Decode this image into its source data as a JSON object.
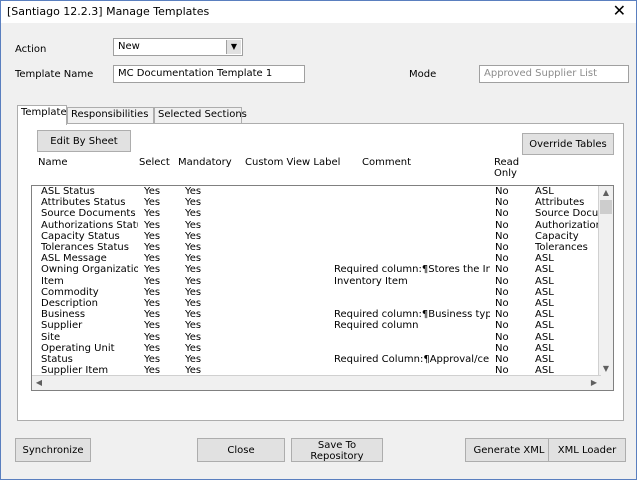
{
  "window": {
    "title": "[Santiago 12.2.3] Manage Templates",
    "close_glyph": "✕"
  },
  "form": {
    "action_label": "Action",
    "action_value": "New",
    "template_name_label": "Template Name",
    "template_name_value": "MC Documentation Template 1",
    "mode_label": "Mode",
    "mode_value": "Approved Supplier List"
  },
  "tabs": [
    {
      "label": "Template",
      "active": true
    },
    {
      "label": "Responsibilities",
      "active": false
    },
    {
      "label": "Selected Sections",
      "active": false
    }
  ],
  "template_tab": {
    "edit_button": "Edit By Sheet",
    "override_button": "Override Tables",
    "columns": {
      "name": "Name",
      "select": "Select",
      "mandatory": "Mandatory",
      "custom_view_label": "Custom View Label",
      "comment": "Comment",
      "read_only_1": "Read",
      "read_only_2": "Only"
    },
    "rows": [
      {
        "name": "ASL Status",
        "select": "Yes",
        "mandatory": "Yes",
        "comment": "",
        "read_only": "No",
        "table": "ASL"
      },
      {
        "name": "Attributes Status",
        "select": "Yes",
        "mandatory": "Yes",
        "comment": "",
        "read_only": "No",
        "table": "Attributes"
      },
      {
        "name": "Source Documents Stat",
        "select": "Yes",
        "mandatory": "Yes",
        "comment": "",
        "read_only": "No",
        "table": "Source Docume"
      },
      {
        "name": "Authorizations Status",
        "select": "Yes",
        "mandatory": "Yes",
        "comment": "",
        "read_only": "No",
        "table": "Authorizations"
      },
      {
        "name": "Capacity Status",
        "select": "Yes",
        "mandatory": "Yes",
        "comment": "",
        "read_only": "No",
        "table": "Capacity"
      },
      {
        "name": "Tolerances Status",
        "select": "Yes",
        "mandatory": "Yes",
        "comment": "",
        "read_only": "No",
        "table": "Tolerances"
      },
      {
        "name": "ASL Message",
        "select": "Yes",
        "mandatory": "Yes",
        "comment": "",
        "read_only": "No",
        "table": "ASL"
      },
      {
        "name": "Owning Organization",
        "select": "Yes",
        "mandatory": "Yes",
        "comment": "Required column:¶Stores the Invento",
        "read_only": "No",
        "table": "ASL"
      },
      {
        "name": "Item",
        "select": "Yes",
        "mandatory": "Yes",
        "comment": "Inventory Item",
        "read_only": "No",
        "table": "ASL"
      },
      {
        "name": "Commodity",
        "select": "Yes",
        "mandatory": "Yes",
        "comment": "",
        "read_only": "No",
        "table": "ASL"
      },
      {
        "name": "Description",
        "select": "Yes",
        "mandatory": "Yes",
        "comment": "",
        "read_only": "No",
        "table": "ASL"
      },
      {
        "name": "Business",
        "select": "Yes",
        "mandatory": "Yes",
        "comment": "Required column:¶Business type of D",
        "read_only": "No",
        "table": "ASL"
      },
      {
        "name": "Supplier",
        "select": "Yes",
        "mandatory": "Yes",
        "comment": "Required column",
        "read_only": "No",
        "table": "ASL"
      },
      {
        "name": "Site",
        "select": "Yes",
        "mandatory": "Yes",
        "comment": "",
        "read_only": "No",
        "table": "ASL"
      },
      {
        "name": "Operating Unit",
        "select": "Yes",
        "mandatory": "Yes",
        "comment": "",
        "read_only": "No",
        "table": "ASL"
      },
      {
        "name": "Status",
        "select": "Yes",
        "mandatory": "Yes",
        "comment": "Required Column:¶Approval/certifica",
        "read_only": "No",
        "table": "ASL"
      },
      {
        "name": "Supplier Item",
        "select": "Yes",
        "mandatory": "Yes",
        "comment": "",
        "read_only": "No",
        "table": "ASL"
      }
    ]
  },
  "footer": {
    "synchronize": "Synchronize",
    "close": "Close",
    "save_to_repository": "Save To Repository",
    "generate_xml": "Generate XML",
    "xml_loader": "XML Loader"
  }
}
